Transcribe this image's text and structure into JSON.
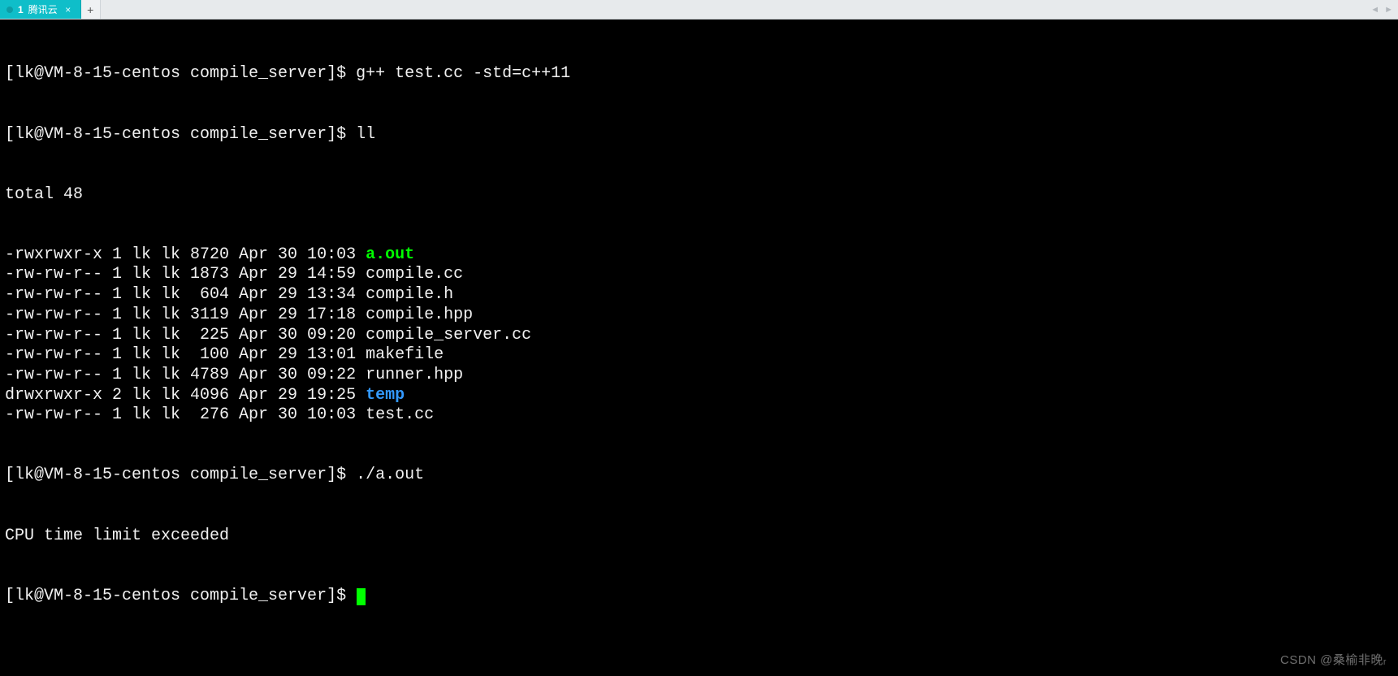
{
  "tabs": {
    "active": {
      "index": "1",
      "title": "腾讯云",
      "close_glyph": "×"
    },
    "add_glyph": "+",
    "nav_left": "◄",
    "nav_right": "►"
  },
  "terminal": {
    "prompt": "[lk@VM-8-15-centos compile_server]$ ",
    "commands": {
      "c1": "g++ test.cc -std=c++11",
      "c2": "ll",
      "c3": "./a.out"
    },
    "ll_header": "total 48",
    "listing": [
      {
        "perm": "-rwxrwxr-x",
        "links": "1",
        "own": "lk",
        "grp": "lk",
        "size": "8720",
        "date": "Apr 30 10:03",
        "name": "a.out",
        "cls": "green"
      },
      {
        "perm": "-rw-rw-r--",
        "links": "1",
        "own": "lk",
        "grp": "lk",
        "size": "1873",
        "date": "Apr 29 14:59",
        "name": "compile.cc",
        "cls": ""
      },
      {
        "perm": "-rw-rw-r--",
        "links": "1",
        "own": "lk",
        "grp": "lk",
        "size": " 604",
        "date": "Apr 29 13:34",
        "name": "compile.h",
        "cls": ""
      },
      {
        "perm": "-rw-rw-r--",
        "links": "1",
        "own": "lk",
        "grp": "lk",
        "size": "3119",
        "date": "Apr 29 17:18",
        "name": "compile.hpp",
        "cls": ""
      },
      {
        "perm": "-rw-rw-r--",
        "links": "1",
        "own": "lk",
        "grp": "lk",
        "size": " 225",
        "date": "Apr 30 09:20",
        "name": "compile_server.cc",
        "cls": ""
      },
      {
        "perm": "-rw-rw-r--",
        "links": "1",
        "own": "lk",
        "grp": "lk",
        "size": " 100",
        "date": "Apr 29 13:01",
        "name": "makefile",
        "cls": ""
      },
      {
        "perm": "-rw-rw-r--",
        "links": "1",
        "own": "lk",
        "grp": "lk",
        "size": "4789",
        "date": "Apr 30 09:22",
        "name": "runner.hpp",
        "cls": ""
      },
      {
        "perm": "drwxrwxr-x",
        "links": "2",
        "own": "lk",
        "grp": "lk",
        "size": "4096",
        "date": "Apr 29 19:25",
        "name": "temp",
        "cls": "blue"
      },
      {
        "perm": "-rw-rw-r--",
        "links": "1",
        "own": "lk",
        "grp": "lk",
        "size": " 276",
        "date": "Apr 30 10:03",
        "name": "test.cc",
        "cls": ""
      }
    ],
    "output": "CPU time limit exceeded"
  },
  "watermark": "CSDN @桑榆非晚ᵣ"
}
